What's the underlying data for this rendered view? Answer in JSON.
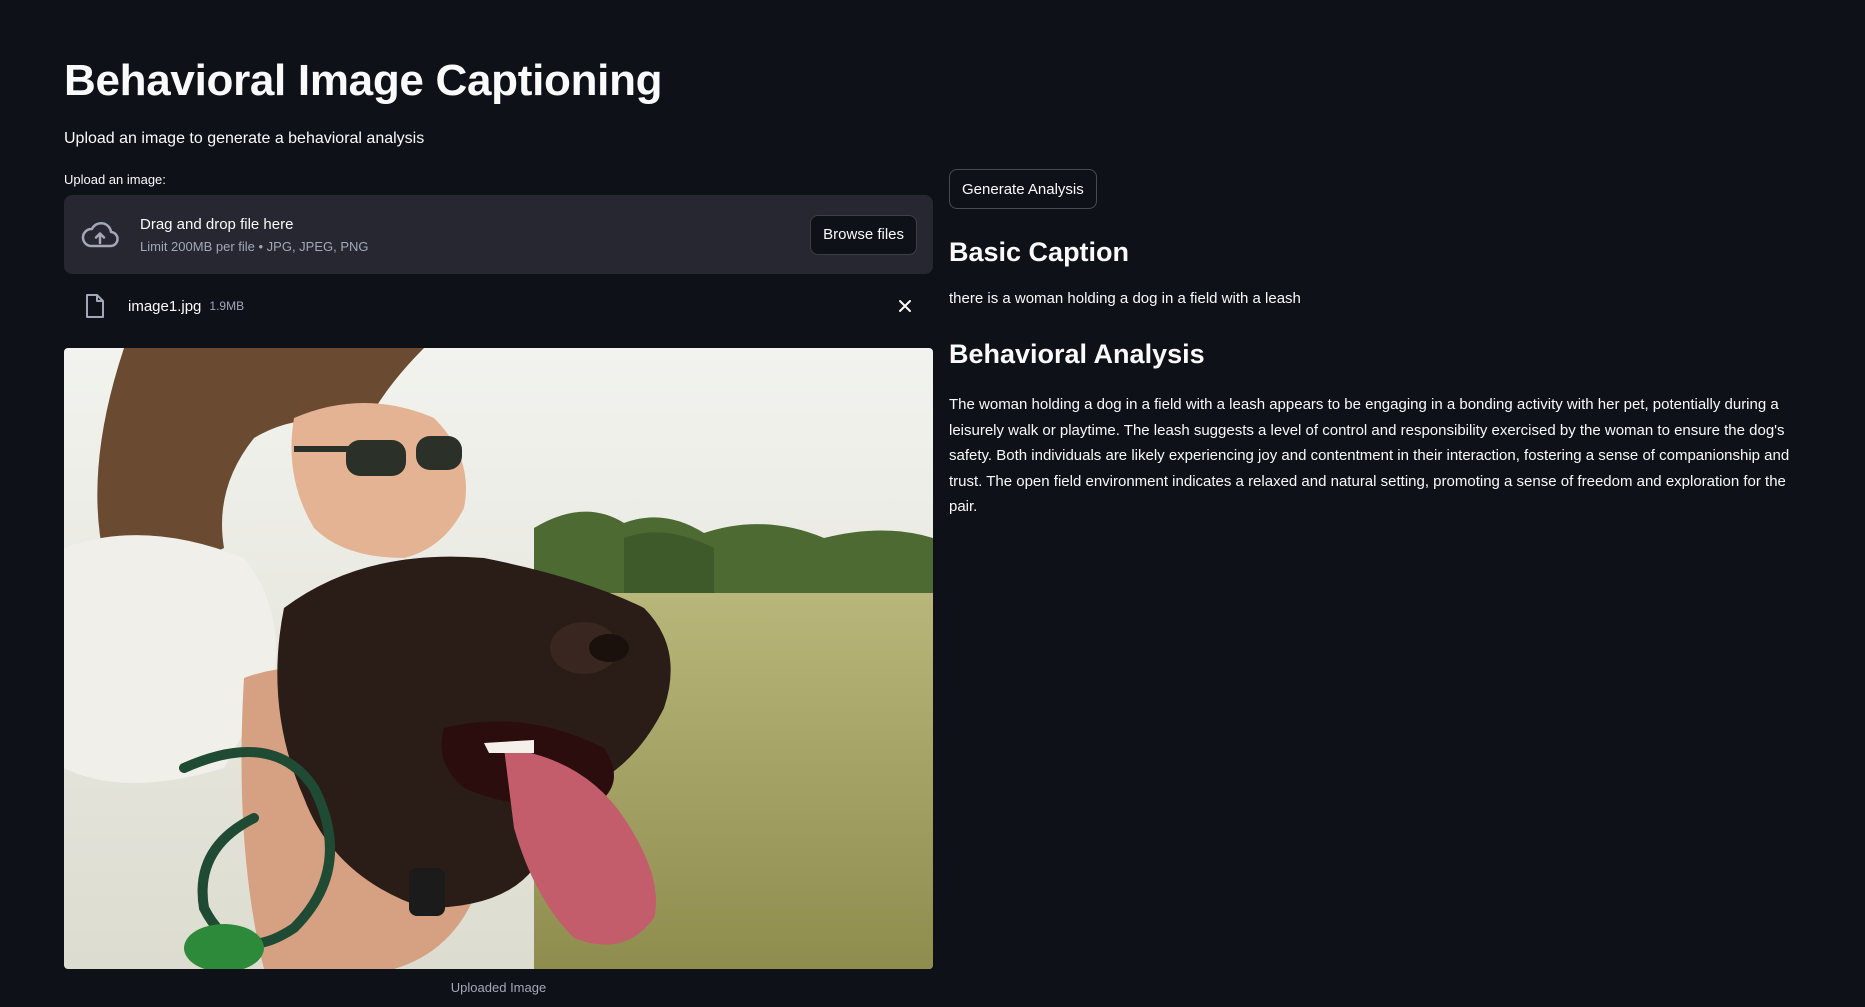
{
  "header": {
    "title": "Behavioral Image Captioning",
    "subtitle": "Upload an image to generate a behavioral analysis"
  },
  "uploader": {
    "label": "Upload an image:",
    "drop_text": "Drag and drop file here",
    "limit_text": "Limit 200MB per file • JPG, JPEG, PNG",
    "browse_label": "Browse files",
    "file": {
      "name": "image1.jpg",
      "size": "1.9MB"
    }
  },
  "image": {
    "caption": "Uploaded Image",
    "icon": "photo-woman-with-dog"
  },
  "actions": {
    "generate_label": "Generate Analysis"
  },
  "results": {
    "basic_heading": "Basic Caption",
    "basic_text": "there is a woman holding a dog in a field with a leash",
    "behavioral_heading": "Behavioral Analysis",
    "behavioral_text": "The woman holding a dog in a field with a leash appears to be engaging in a bonding activity with her pet, potentially during a leisurely walk or playtime. The leash suggests a level of control and responsibility exercised by the woman to ensure the dog's safety. Both individuals are likely experiencing joy and contentment in their interaction, fostering a sense of companionship and trust. The open field environment indicates a relaxed and natural setting, promoting a sense of freedom and exploration for the pair."
  },
  "colors": {
    "background": "#0e1117",
    "dropzone": "#262730",
    "text": "#fafafa",
    "muted": "#a3a8b8"
  }
}
